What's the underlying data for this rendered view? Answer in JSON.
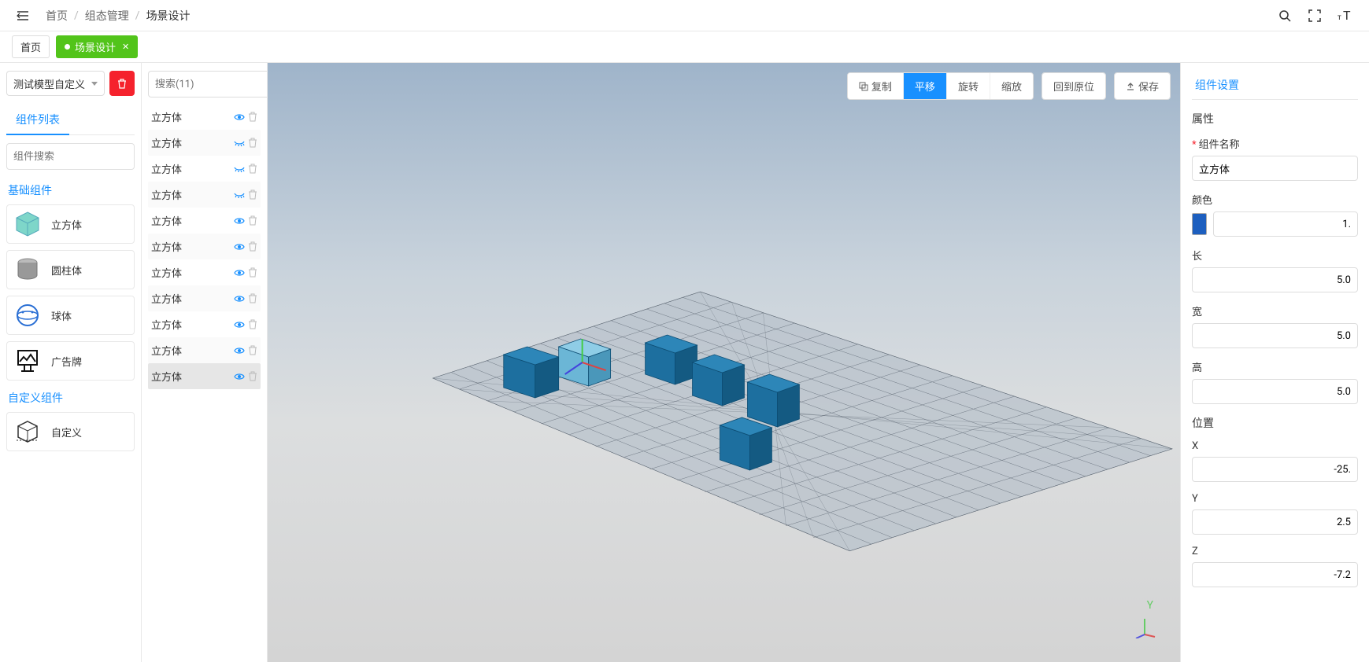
{
  "breadcrumb": {
    "home": "首页",
    "group": "组态管理",
    "scene": "场景设计"
  },
  "tabs": {
    "home": "首页",
    "scene": "场景设计"
  },
  "leftPanel": {
    "modelSelect": "测试模型自定义",
    "tabLabel": "组件列表",
    "searchPlaceholder": "组件搜索",
    "sec1": "基础组件",
    "sec2": "自定义组件",
    "items": {
      "cube": "立方体",
      "cylinder": "圆柱体",
      "sphere": "球体",
      "billboard": "广告牌",
      "custom": "自定义"
    }
  },
  "hierarchy": {
    "searchPlaceholder": "搜索(11)",
    "items": [
      {
        "label": "立方体",
        "iconType": "eye",
        "shaded": false
      },
      {
        "label": "立方体",
        "iconType": "wave",
        "shaded": true
      },
      {
        "label": "立方体",
        "iconType": "wave",
        "shaded": false
      },
      {
        "label": "立方体",
        "iconType": "wave",
        "shaded": true
      },
      {
        "label": "立方体",
        "iconType": "eye",
        "shaded": false
      },
      {
        "label": "立方体",
        "iconType": "eye",
        "shaded": true
      },
      {
        "label": "立方体",
        "iconType": "eye",
        "shaded": false
      },
      {
        "label": "立方体",
        "iconType": "eye",
        "shaded": true
      },
      {
        "label": "立方体",
        "iconType": "eye",
        "shaded": false
      },
      {
        "label": "立方体",
        "iconType": "eye",
        "shaded": true
      },
      {
        "label": "立方体",
        "iconType": "eye",
        "shaded": false,
        "selected": true
      }
    ]
  },
  "toolbar": {
    "copy": "复制",
    "move": "平移",
    "rotate": "旋转",
    "scale": "缩放",
    "reset": "回到原位",
    "save": "保存"
  },
  "rightPanel": {
    "tab": "组件设置",
    "section": "属性",
    "nameLabel": "组件名称",
    "nameValue": "立方体",
    "colorLabel": "颜色",
    "colorAlpha": "1.",
    "lenLabel": "长",
    "lenValue": "5.0",
    "widthLabel": "宽",
    "widthValue": "5.0",
    "heightLabel": "高",
    "heightValue": "5.0",
    "posLabel": "位置",
    "xLabel": "X",
    "xValue": "-25.",
    "yLabel": "Y",
    "yValue": "2.5",
    "zLabel": "Z",
    "zValue": "-7.2"
  },
  "axis": {
    "y": "Y"
  }
}
